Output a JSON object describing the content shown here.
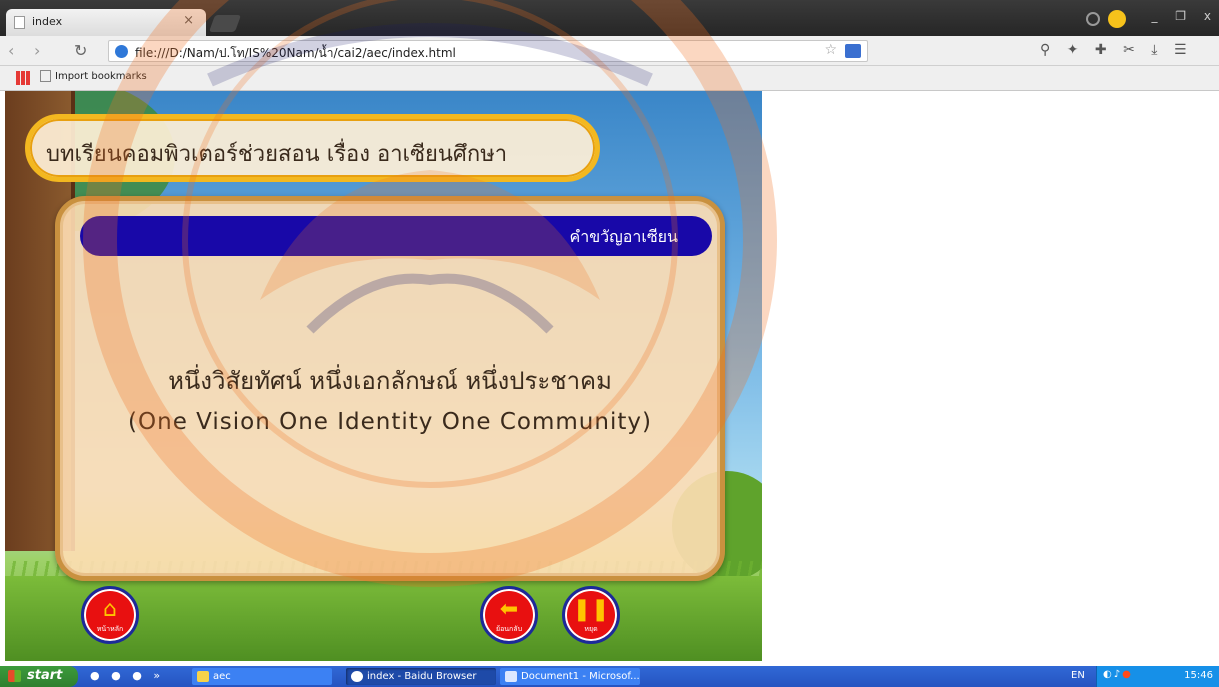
{
  "browser": {
    "tab_title": "index",
    "tab_close": "×",
    "url": "file:///D:/Nam/ป.โท/IS%20Nam/น้ำ/cai2/aec/index.html",
    "bookmark_item": "Import bookmarks",
    "window_controls": [
      "_",
      "❐",
      "x"
    ]
  },
  "lesson": {
    "title": "บทเรียนคอมพิวเตอร์ช่วยสอน  เรื่อง  อาเซียนศึกษา",
    "section_header": "คำขวัญอาเซียน",
    "motto_thai": "หนึ่งวิสัยทัศน์  หนึ่งเอกลักษณ์  หนึ่งประชาคม",
    "motto_english": "(One  Vision  One  Identity   One  Community)",
    "home_caption": "หน้าหลัก",
    "back_caption": "ย้อนกลับ",
    "pause_caption": "หยุด"
  },
  "taskbar": {
    "start_label": "start",
    "tasks": [
      {
        "label": "aec",
        "icon": "folder-icon"
      },
      {
        "label": "index - Baidu Browser",
        "icon": "browser-icon"
      },
      {
        "label": "Document1 - Microsof...",
        "icon": "word-icon"
      }
    ],
    "language": "EN",
    "clock": "15:46"
  },
  "colors": {
    "header_bar": "#1808a8",
    "title_border": "#f3b820",
    "button_red": "#e81010",
    "taskbar_blue": "#2554c1"
  }
}
